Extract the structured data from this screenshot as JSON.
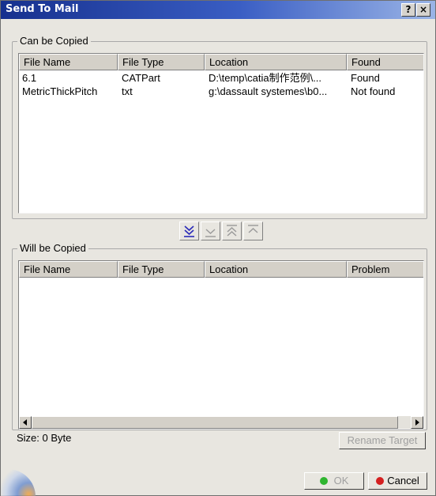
{
  "window": {
    "title": "Send To Mail",
    "help_label": "?",
    "close_label": "×"
  },
  "can_be_copied": {
    "legend": "Can be Copied",
    "columns": [
      "File Name",
      "File Type",
      "Location",
      "Found"
    ],
    "rows": [
      {
        "file_name": "6.1",
        "file_type": "CATPart",
        "location": "D:\\temp\\catia制作范例\\...",
        "found": "Found"
      },
      {
        "file_name": "MetricThickPitch",
        "file_type": "txt",
        "location": "g:\\dassault systemes\\b0...",
        "found": "Not found"
      }
    ]
  },
  "transfer_buttons": {
    "icons": [
      "double-chevron-down-icon",
      "chevron-down-icon",
      "double-chevron-up-icon",
      "chevron-up-icon"
    ]
  },
  "will_be_copied": {
    "legend": "Will be Copied",
    "columns": [
      "File Name",
      "File Type",
      "Location",
      "Problem"
    ],
    "rows": []
  },
  "size_label": "Size: 0 Byte",
  "buttons": {
    "rename_target": "Rename Target",
    "ok": "OK",
    "cancel": "Cancel"
  },
  "colors": {
    "title_bar_start": "#16308e",
    "title_bar_end": "#9ab4e6",
    "dialog_bg": "#e8e6e0",
    "ok_dot": "#2fb52f",
    "cancel_dot": "#d42020"
  }
}
